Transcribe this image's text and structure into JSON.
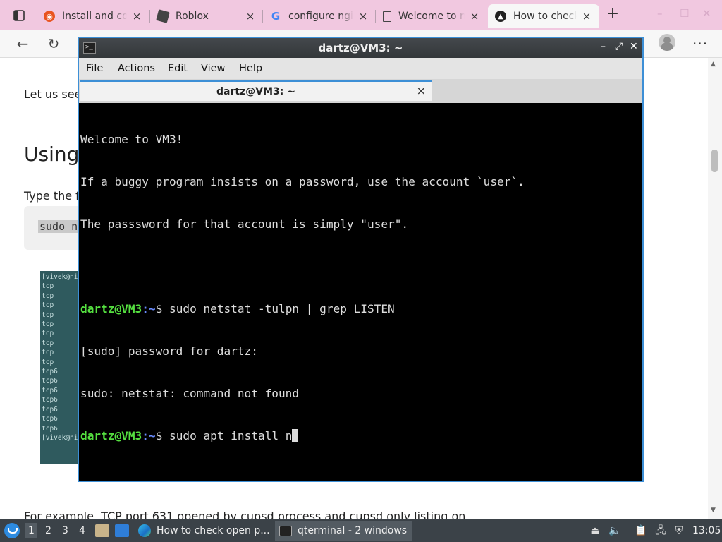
{
  "browser": {
    "tabs": [
      {
        "label": "Install and configure",
        "favicon": "ubuntu-icon",
        "active": false
      },
      {
        "label": "Roblox",
        "favicon": "roblox-icon",
        "active": false
      },
      {
        "label": "configure nginx",
        "favicon": "google-icon",
        "active": false
      },
      {
        "label": "Welcome to nginx",
        "favicon": "page-icon",
        "active": false
      },
      {
        "label": "How to check open ports",
        "favicon": "linux-penguin-icon",
        "active": true
      }
    ],
    "tab_close_glyph": "×",
    "new_tab_glyph": "+",
    "back_glyph": "←",
    "reload_glyph": "↻",
    "menu_glyph": "···",
    "window_controls": [
      "–",
      "☐",
      "✕"
    ]
  },
  "webpage": {
    "intro_text": "Let us see",
    "heading": "Using",
    "type_text": "Type the f",
    "code_snippet": "sudo n",
    "image_lines": [
      "[vivek@ni",
      "tcp",
      "tcp",
      "tcp",
      "tcp",
      "tcp",
      "tcp",
      "tcp",
      "tcp",
      "tcp",
      "tcp6",
      "tcp6",
      "tcp6",
      "tcp6",
      "tcp6",
      "tcp6",
      "tcp6",
      "[vivek@ni"
    ],
    "bottom_text": "For example, TCP port 631 opened by cupsd process and cupsd only listing on"
  },
  "terminal": {
    "window_title": "dartz@VM3: ~",
    "menu": [
      "File",
      "Actions",
      "Edit",
      "View",
      "Help"
    ],
    "tab_title": "dartz@VM3: ~",
    "tab_close": "×",
    "title_buttons": [
      "–",
      "⤢",
      "✕"
    ],
    "welcome_lines": [
      "Welcome to VM3!",
      "If a buggy program insists on a password, use the account `user`.",
      "The passsword for that account is simply \"user\"."
    ],
    "prompt_user": "dartz@VM3",
    "prompt_path": ":~",
    "prompt_symbol": "$ ",
    "command_1": "sudo netstat -tulpn | grep LISTEN",
    "output_1": "[sudo] password for dartz:",
    "output_2": "sudo: netstat: command not found",
    "command_2": "sudo apt install n"
  },
  "taskbar": {
    "desktops": [
      "1",
      "2",
      "3",
      "4"
    ],
    "active_desktop": "1",
    "tasks": [
      {
        "label": "How to check open p...",
        "icon": "edge-icon"
      },
      {
        "label": "qterminal - 2 windows",
        "icon": "terminal-icon"
      }
    ],
    "clock": "13:05"
  },
  "colors": {
    "tabbar": "#f1c8e0",
    "terminal_border": "#3d8fd6",
    "prompt_user": "#55e040",
    "prompt_path": "#6a8cff",
    "taskbar": "#3b4248"
  }
}
